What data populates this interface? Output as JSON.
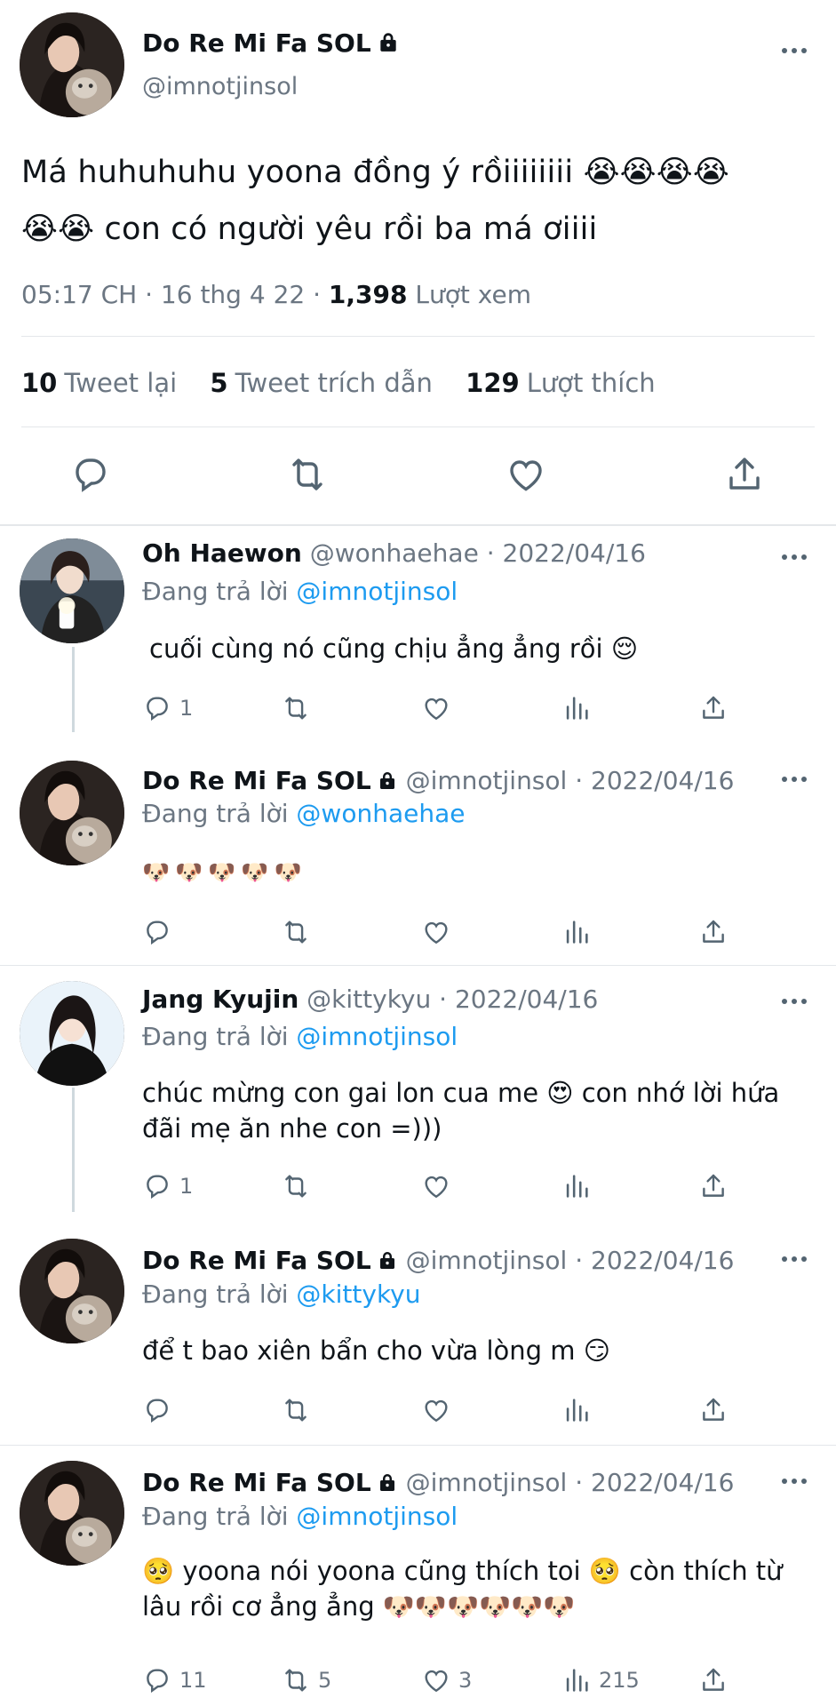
{
  "main_tweet": {
    "display_name": "Do Re Mi Fa SOL",
    "handle": "@imnotjinsol",
    "text_line1": "Má huhuhuhu yoona đồng ý rồiiiiiiii 😭😭😭😭",
    "text_line2": "😭😭 con có người yêu rồi ba má ơiiii",
    "time": "05:17 CH",
    "date": "16 thg 4 22",
    "views_count": "1,398",
    "views_label": "Lượt xem",
    "retweets_count": "10",
    "retweets_label": "Tweet lại",
    "quotes_count": "5",
    "quotes_label": "Tweet trích dẫn",
    "likes_count": "129",
    "likes_label": "Lượt thích"
  },
  "replies": [
    {
      "display_name": "Oh Haewon",
      "handle": "@wonhaehae",
      "date": "2022/04/16",
      "replying_label": "Đang trả lời",
      "replying_to": "@imnotjinsol",
      "text": "cuối cùng nó cũng chịu ẳng ẳng rồi 😌",
      "reply_count": "1",
      "retweet_count": "",
      "like_count": "",
      "view_count": ""
    },
    {
      "display_name": "Do Re Mi Fa SOL",
      "handle": "@imnotjinsol",
      "date": "2022/04/16",
      "replying_label": "Đang trả lời",
      "replying_to": "@wonhaehae",
      "text": "🐶🐶🐶🐶🐶",
      "reply_count": "",
      "retweet_count": "",
      "like_count": "",
      "view_count": ""
    },
    {
      "display_name": "Jang Kyujin",
      "handle": "@kittykyu",
      "date": "2022/04/16",
      "replying_label": "Đang trả lời",
      "replying_to": "@imnotjinsol",
      "text_line1": "chúc mừng con gai lon cua me 😍  con nhớ lời hứa",
      "text_line2": "đãi mẹ ăn nhe con =)))",
      "reply_count": "1",
      "retweet_count": "",
      "like_count": "",
      "view_count": ""
    },
    {
      "display_name": "Do Re Mi Fa SOL",
      "handle": "@imnotjinsol",
      "date": "2022/04/16",
      "replying_label": "Đang trả lời",
      "replying_to": "@kittykyu",
      "text": "để t bao xiên bẩn cho vừa lòng m 😏",
      "reply_count": "",
      "retweet_count": "",
      "like_count": "",
      "view_count": ""
    },
    {
      "display_name": "Do Re Mi Fa SOL",
      "handle": "@imnotjinsol",
      "date": "2022/04/16",
      "replying_label": "Đang trả lời",
      "replying_to": "@imnotjinsol",
      "text_line1": "🥺 yoona nói yoona cũng thích toi 🥺  còn thích từ",
      "text_line2": "lâu rồi cơ ẳng ẳng 🐶🐶🐶🐶🐶🐶",
      "reply_count": "11",
      "retweet_count": "5",
      "like_count": "3",
      "view_count": "215"
    }
  ],
  "separator": "·",
  "colors": {
    "text": "#0f1419",
    "secondary": "#6b7682",
    "link": "#1d9bf0",
    "divider": "#e4e7ea"
  }
}
